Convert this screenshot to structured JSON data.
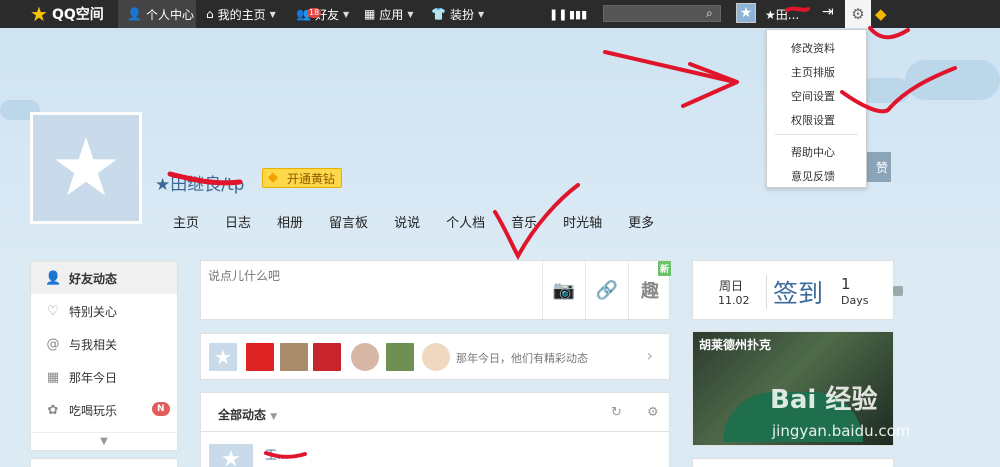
{
  "topbar": {
    "logo": "QQ空间",
    "items": [
      {
        "label": "个人中心"
      },
      {
        "label": "我的主页"
      },
      {
        "label": "好友",
        "badge": "18"
      },
      {
        "label": "应用"
      },
      {
        "label": "装扮"
      }
    ],
    "username": "★田..."
  },
  "dropdown": {
    "items": [
      "修改资料",
      "主页排版",
      "空间设置",
      "权限设置",
      "帮助中心",
      "意见反馈"
    ]
  },
  "profile": {
    "name": "★田继良/tp",
    "vip_label": "开通黄钻",
    "cover_button": "赞"
  },
  "nav": [
    "主页",
    "日志",
    "相册",
    "留言板",
    "说说",
    "个人档",
    "音乐",
    "时光轴",
    "更多"
  ],
  "sidebar": {
    "items": [
      {
        "label": "好友动态",
        "icon": "person-icon",
        "glyph": "👤"
      },
      {
        "label": "特别关心",
        "icon": "heart-icon",
        "glyph": "♡"
      },
      {
        "label": "与我相关",
        "icon": "at-icon",
        "glyph": "@"
      },
      {
        "label": "那年今日",
        "icon": "calendar-icon",
        "glyph": "▦"
      },
      {
        "label": "吃喝玩乐",
        "icon": "gift-icon",
        "glyph": "✿"
      }
    ],
    "new_badge": "N"
  },
  "composer": {
    "placeholder": "说点儿什么吧",
    "new_tag": "新",
    "fun_label": "趣"
  },
  "today": {
    "text": "那年今日，他们有精彩动态"
  },
  "feed": {
    "title": "全部动态",
    "poster_name": "王..."
  },
  "signin": {
    "day": "周日",
    "date": "11.02",
    "label": "签到",
    "count": "1",
    "unit": "Days"
  },
  "ad": {
    "title": "胡莱德州扑克"
  },
  "watermark": {
    "brand": "Bai  经验",
    "url": "jingyan.baidu.com"
  },
  "colors": {
    "topbar": "#2b2b2b",
    "accent": "#3c6a99",
    "annotation": "#e0152b",
    "vip": "#ffd84a"
  }
}
